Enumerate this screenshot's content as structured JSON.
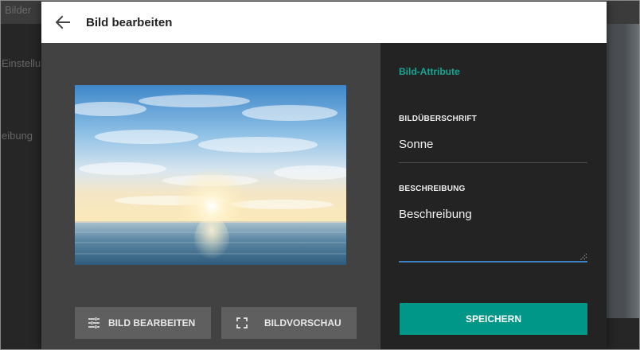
{
  "background": {
    "topbar_fragment": "Bilder",
    "side_fragment_1": "Einstellu",
    "side_fragment_2": "eibung"
  },
  "modal": {
    "title": "Bild bearbeiten",
    "back_icon": "arrow-left-icon"
  },
  "preview": {
    "image_subject": "sunrise over sea with cloudy sky",
    "edit_button_label": "BILD BEARBEITEN",
    "edit_button_icon": "tune-sliders-icon",
    "preview_button_label": "BILDVORSCHAU",
    "preview_button_icon": "fullscreen-icon"
  },
  "attributes": {
    "section_title": "Bild-Attribute",
    "caption_label": "BILDÜBERSCHRIFT",
    "caption_value": "Sonne",
    "description_label": "BESCHREIBUNG",
    "description_value": "Beschreibung",
    "save_label": "SPEICHERN"
  },
  "colors": {
    "accent": "#009688",
    "accent_text": "#1aa491",
    "focus_line": "#3b82c4",
    "header_bg": "#ffffff",
    "left_pane_bg": "#424242",
    "right_pane_bg": "#232323"
  }
}
